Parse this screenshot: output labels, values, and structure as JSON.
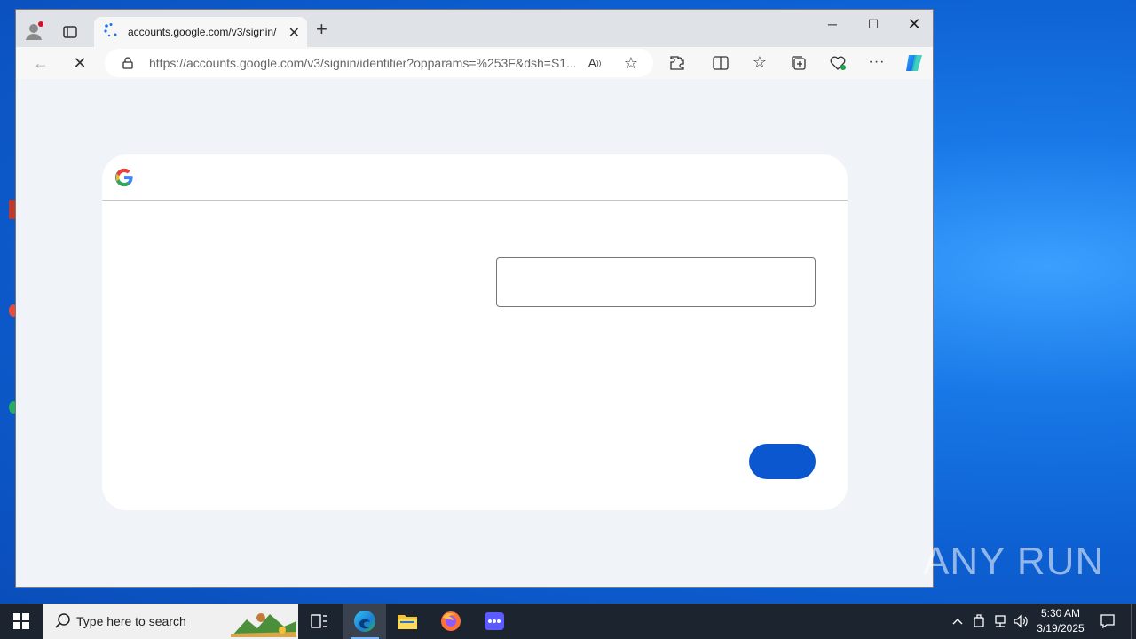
{
  "browser": {
    "tab_title": "accounts.google.com/v3/signin/",
    "address_domain": "https://accounts.google.com",
    "address_path": "/v3/signin/identifier?opparams=%253F&dsh=S1..."
  },
  "page": {
    "email_value": "",
    "next_label": ""
  },
  "taskbar": {
    "search_placeholder": "Type here to search",
    "time": "5:30 AM",
    "date": "3/19/2025"
  },
  "watermark": "ANY RUN",
  "colors": {
    "next_button": "#0b57d0",
    "page_background": "#f0f4f9",
    "taskbar": "#1c2430"
  }
}
